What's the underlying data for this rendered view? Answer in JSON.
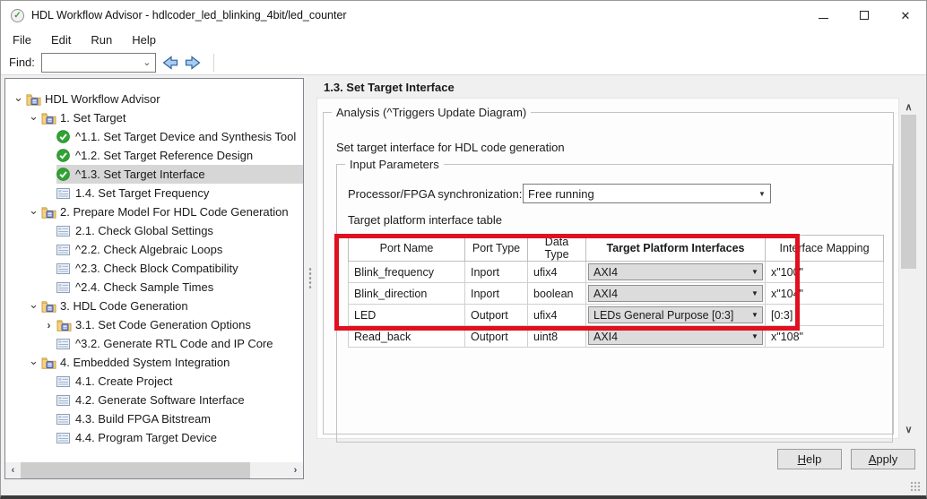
{
  "window": {
    "title": "HDL Workflow Advisor - hdlcoder_led_blinking_4bit/led_counter"
  },
  "menus": {
    "file": "File",
    "edit": "Edit",
    "run": "Run",
    "help": "Help"
  },
  "toolbar": {
    "find_label": "Find:",
    "find_value": ""
  },
  "icons": {
    "app_check": "✓",
    "chevron_expanded": "⌄",
    "chevron_collapsed": "›",
    "combo_arrow": "⌄",
    "dropdown_arrow": "▼",
    "scroll_up": "∧",
    "scroll_down": "∨",
    "scroll_left": "‹",
    "scroll_right": "›",
    "close": "✕"
  },
  "tree": {
    "items": [
      {
        "label": "HDL Workflow Advisor"
      },
      {
        "label": "1. Set Target"
      },
      {
        "label": "^1.1. Set Target Device and Synthesis Tool"
      },
      {
        "label": "^1.2. Set Target Reference Design"
      },
      {
        "label": "^1.3. Set Target Interface"
      },
      {
        "label": "1.4. Set Target Frequency"
      },
      {
        "label": "2. Prepare Model For HDL Code Generation"
      },
      {
        "label": "2.1. Check Global Settings"
      },
      {
        "label": "^2.2. Check Algebraic Loops"
      },
      {
        "label": "^2.3. Check Block Compatibility"
      },
      {
        "label": "^2.4. Check Sample Times"
      },
      {
        "label": "3. HDL Code Generation"
      },
      {
        "label": "3.1. Set Code Generation Options"
      },
      {
        "label": "^3.2. Generate RTL Code and IP Core"
      },
      {
        "label": "4. Embedded System Integration"
      },
      {
        "label": "4.1. Create Project"
      },
      {
        "label": "4.2. Generate Software Interface"
      },
      {
        "label": "4.3. Build FPGA Bitstream"
      },
      {
        "label": "4.4. Program Target Device"
      }
    ]
  },
  "panel": {
    "heading": "1.3. Set Target Interface",
    "analysis_group": "Analysis (^Triggers Update Diagram)",
    "description": "Set target interface for HDL code generation",
    "input_group": "Input Parameters",
    "sync_label": "Processor/FPGA synchronization:",
    "sync_value": "Free running",
    "table_label": "Target platform interface table",
    "table": {
      "columns": [
        "Port Name",
        "Port Type",
        "Data Type",
        "Target Platform Interfaces",
        "Interface Mapping"
      ],
      "rows": [
        {
          "port_name": "Blink_frequency",
          "port_type": "Inport",
          "data_type": "ufix4",
          "interface": "AXI4",
          "mapping": "x\"100\""
        },
        {
          "port_name": "Blink_direction",
          "port_type": "Inport",
          "data_type": "boolean",
          "interface": "AXI4",
          "mapping": "x\"104\""
        },
        {
          "port_name": "LED",
          "port_type": "Outport",
          "data_type": "ufix4",
          "interface": "LEDs General Purpose [0:3]",
          "mapping": "[0:3]"
        },
        {
          "port_name": "Read_back",
          "port_type": "Outport",
          "data_type": "uint8",
          "interface": "AXI4",
          "mapping": "x\"108\""
        }
      ]
    }
  },
  "buttons": {
    "help": "Help",
    "apply": "Apply"
  },
  "colors": {
    "highlight_red": "#e0101f",
    "check_green": "#31a335",
    "selection_gray": "#d6d6d6"
  }
}
